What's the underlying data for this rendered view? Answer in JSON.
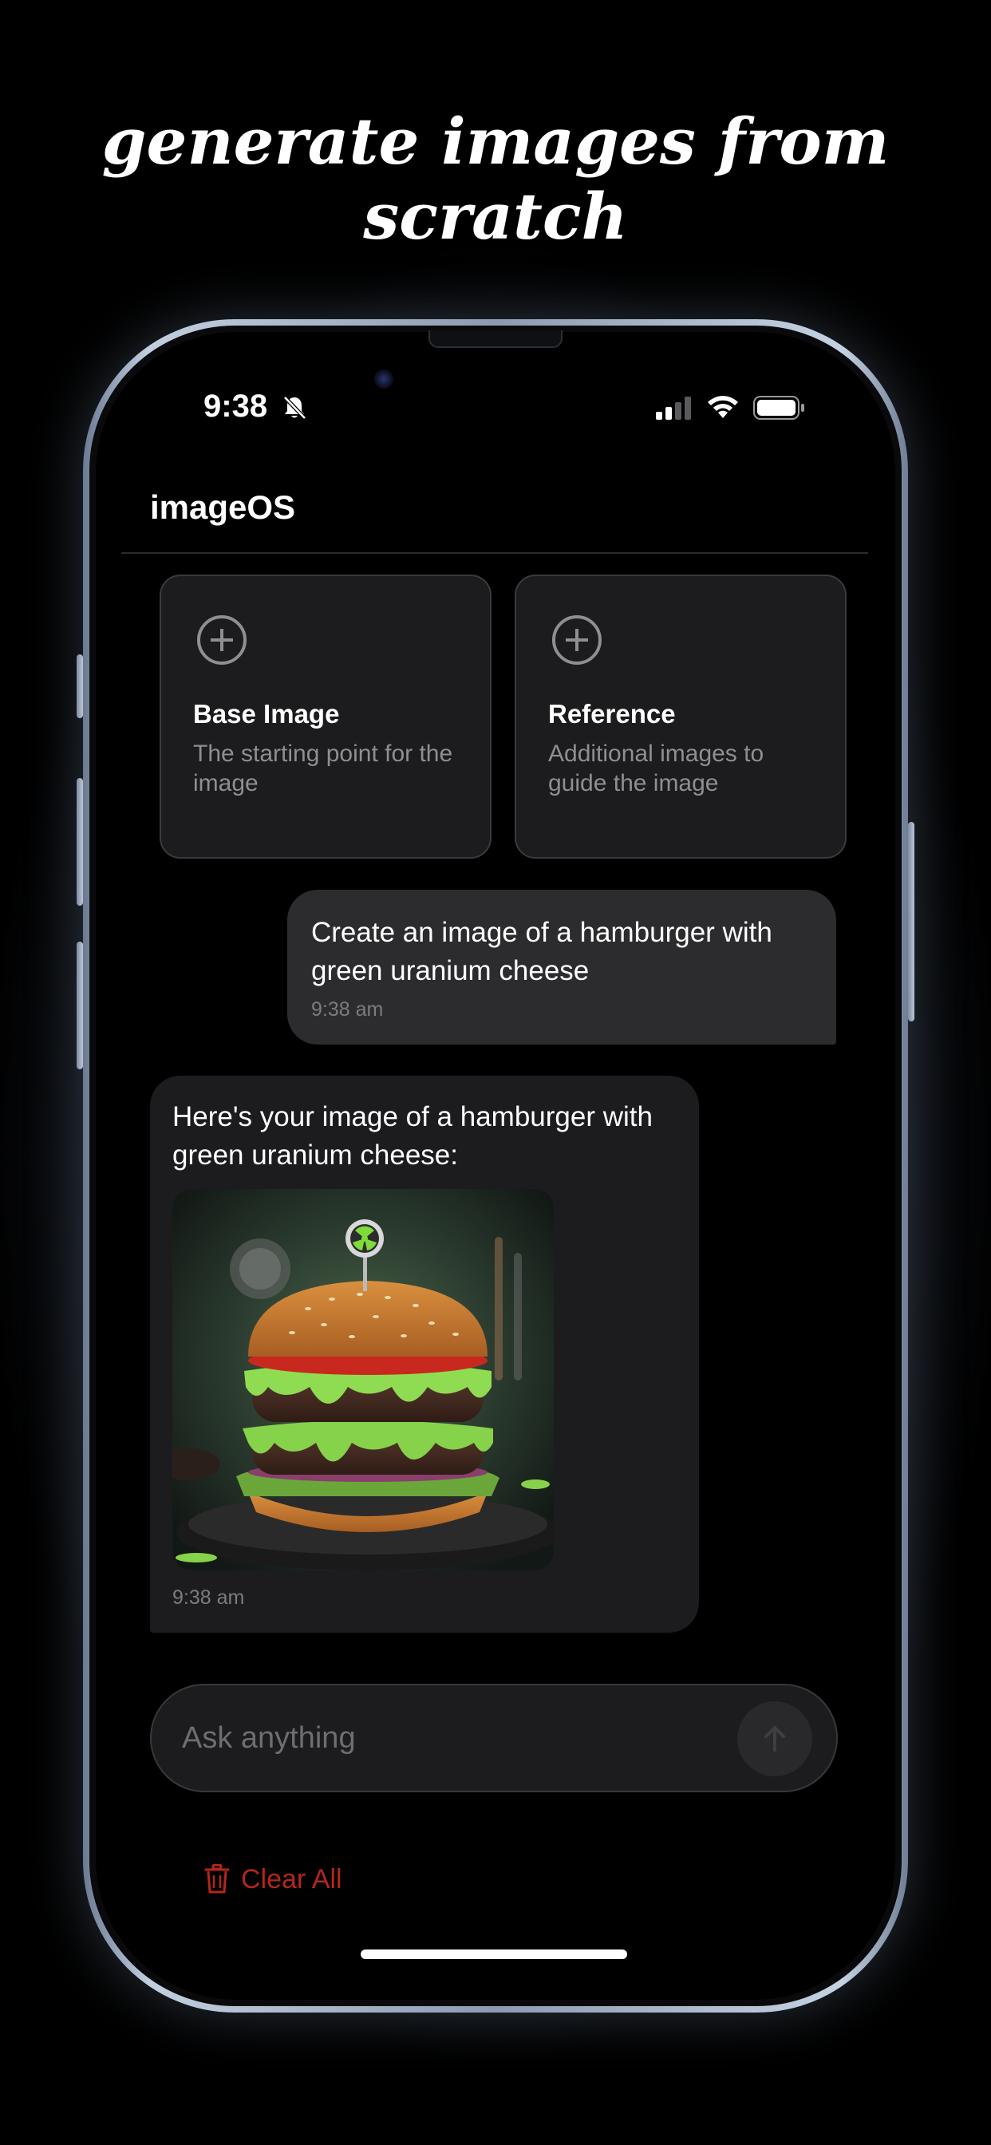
{
  "headline": "generate images from scratch",
  "status_bar": {
    "time": "9:38",
    "icons": [
      "bell-slash-icon",
      "signal-icon",
      "wifi-icon",
      "battery-icon"
    ]
  },
  "app": {
    "title": "imageOS"
  },
  "cards": [
    {
      "title": "Base Image",
      "description": "The starting point for the image",
      "icon": "plus-circle-icon"
    },
    {
      "title": "Reference",
      "description": "Additional images to guide the image",
      "icon": "plus-circle-icon"
    }
  ],
  "messages": [
    {
      "role": "user",
      "text": "Create an image of a hamburger with green uranium cheese",
      "time": "9:38 am"
    },
    {
      "role": "assistant",
      "text": "Here's your image of a hamburger with green uranium cheese:",
      "time": "9:38 am",
      "image": "hamburger-with-green-cheese"
    }
  ],
  "input": {
    "placeholder": "Ask anything",
    "value": "",
    "send_icon": "arrow-up-icon"
  },
  "clear_all": {
    "label": "Clear All",
    "icon": "trash-icon",
    "color": "#b3261e"
  },
  "colors": {
    "background": "#000000",
    "bubble_user": "#2c2c2e",
    "bubble_ai": "#1c1c1e",
    "accent_red": "#b3261e"
  }
}
